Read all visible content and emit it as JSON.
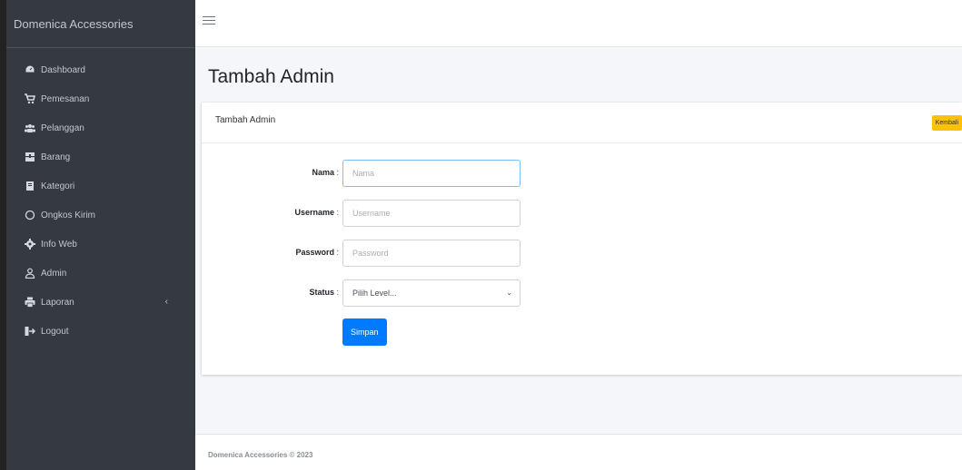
{
  "sidebar": {
    "brand": "Domenica Accessories",
    "items": [
      {
        "label": "Dashboard",
        "icon": "dashboard-icon"
      },
      {
        "label": "Pemesanan",
        "icon": "shopping-cart-icon"
      },
      {
        "label": "Pelanggan",
        "icon": "users-icon"
      },
      {
        "label": "Barang",
        "icon": "box-icon"
      },
      {
        "label": "Kategori",
        "icon": "book-icon"
      },
      {
        "label": "Ongkos Kirim",
        "icon": "circle-icon"
      },
      {
        "label": "Info Web",
        "icon": "gear-icon"
      },
      {
        "label": "Admin",
        "icon": "user-icon"
      },
      {
        "label": "Laporan",
        "icon": "printer-icon",
        "caret": "‹"
      },
      {
        "label": "Logout",
        "icon": "logout-icon"
      }
    ]
  },
  "page": {
    "title": "Tambah Admin"
  },
  "card": {
    "title": "Tambah Admin",
    "back_label": "Kembali"
  },
  "form": {
    "nama": {
      "label": "Nama",
      "colon": " :",
      "placeholder": "Nama",
      "value": ""
    },
    "username": {
      "label": "Username",
      "colon": " :",
      "placeholder": "Username",
      "value": ""
    },
    "password": {
      "label": "Password",
      "colon": " :",
      "placeholder": "Password",
      "value": ""
    },
    "status": {
      "label": "Status",
      "colon": " :",
      "selected": "Pilih Level..."
    },
    "save_label": "Simpan"
  },
  "footer": {
    "text": "Domenica Accessories © 2023"
  },
  "colors": {
    "sidebar_bg": "#343a40",
    "primary": "#007bff",
    "warning": "#ffc107"
  }
}
